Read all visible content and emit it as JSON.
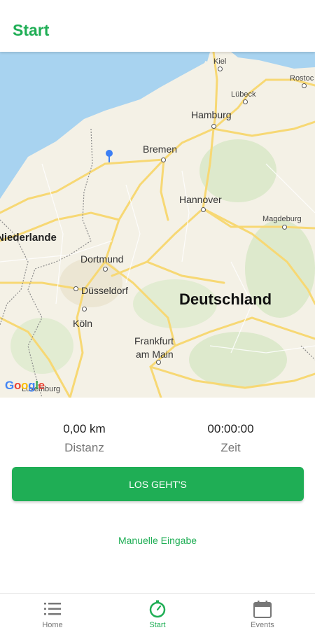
{
  "header": {
    "title": "Start"
  },
  "map": {
    "cities": {
      "kiel": "Kiel",
      "rostock": "Rostoc",
      "luebeck": "Lübeck",
      "hamburg": "Hamburg",
      "bremen": "Bremen",
      "hannover": "Hannover",
      "magdeburg": "Magdeburg",
      "niederlande": "Niederlande",
      "dortmund": "Dortmund",
      "duesseldorf": "Düsseldorf",
      "deutschland": "Deutschland",
      "koeln": "Köln",
      "frankfurt_line1": "Frankfurt",
      "frankfurt_line2": "am Main",
      "luxemburg": "Luxemburg"
    },
    "logo": "Google"
  },
  "stats": {
    "distance_value": "0,00 km",
    "distance_label": "Distanz",
    "time_value": "00:00:00",
    "time_label": "Zeit"
  },
  "actions": {
    "start_label": "LOS GEHT'S",
    "manual_label": "Manuelle Eingabe"
  },
  "tabbar": {
    "items": [
      {
        "label": "Home",
        "icon": "list-icon"
      },
      {
        "label": "Start",
        "icon": "stopwatch-icon"
      },
      {
        "label": "Events",
        "icon": "calendar-icon"
      }
    ]
  },
  "colors": {
    "accent": "#1fae55",
    "water": "#a8d3f0",
    "land": "#f4f1e6",
    "road": "#f7d874",
    "pin": "#3c7ff5"
  }
}
